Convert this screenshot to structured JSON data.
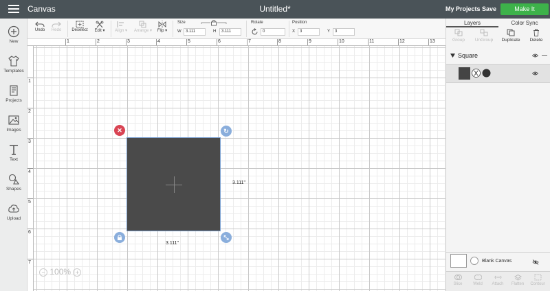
{
  "topbar": {
    "app_title": "Canvas",
    "doc_title": "Untitled*",
    "my_projects": "My Projects",
    "save": "Save",
    "make_it": "Make It",
    "accent_color": "#3db24a",
    "bar_color": "#4a5358"
  },
  "leftbar": {
    "items": [
      {
        "label": "New",
        "icon": "plus-circle-icon"
      },
      {
        "label": "Templates",
        "icon": "shirt-icon"
      },
      {
        "label": "Projects",
        "icon": "projects-icon"
      },
      {
        "label": "Images",
        "icon": "image-icon"
      },
      {
        "label": "Text",
        "icon": "text-icon"
      },
      {
        "label": "Shapes",
        "icon": "shapes-icon"
      },
      {
        "label": "Upload",
        "icon": "upload-cloud-icon"
      }
    ]
  },
  "toolbar": {
    "undo": "Undo",
    "redo": "Redo",
    "deselect": "Deselect",
    "edit": "Edit",
    "align": "Align",
    "arrange": "Arrange",
    "flip": "Flip",
    "size_label": "Size",
    "w_label": "W",
    "w_value": "3.111",
    "h_label": "H",
    "h_value": "3.111",
    "rotate_label": "Rotate",
    "rotate_value": "0",
    "position_label": "Position",
    "x_label": "X",
    "x_value": "3",
    "y_label": "Y",
    "y_value": "3"
  },
  "rulers": {
    "horizontal": [
      "1",
      "2",
      "3",
      "4",
      "5",
      "6",
      "7",
      "8",
      "9",
      "10",
      "11",
      "12",
      "13"
    ],
    "vertical": [
      "1",
      "2",
      "3",
      "4",
      "5",
      "6",
      "7"
    ]
  },
  "canvas": {
    "width_dim": "3.111\"",
    "height_dim": "3.111\"",
    "zoom": "100%",
    "shape_color": "#4a4a4a",
    "delete_color": "#d94453",
    "handle_color": "#8aaedc"
  },
  "rightpanel": {
    "tabs": [
      "Layers",
      "Color Sync"
    ],
    "actions": [
      "Group",
      "UnGroup",
      "Duplicate",
      "Delete"
    ],
    "layer_group": "Square",
    "blank_canvas": "Blank Canvas",
    "bottom_actions": [
      "Slice",
      "Weld",
      "Attach",
      "Flatten",
      "Contour"
    ]
  }
}
